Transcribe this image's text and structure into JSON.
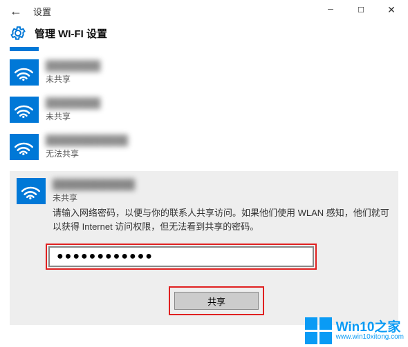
{
  "titlebar": {
    "title": "设置"
  },
  "header": {
    "title": "管理 WI-FI 设置"
  },
  "networks": [
    {
      "name": "████████",
      "status": "未共享"
    },
    {
      "name": "████████",
      "status": "未共享"
    },
    {
      "name": "████████████",
      "status": "无法共享"
    }
  ],
  "selected": {
    "name": "████████████",
    "status": "未共享",
    "description": "请输入网络密码，以便与你的联系人共享访问。如果他们使用 WLAN 感知，他们就可以获得 Internet 访问权限，但无法看到共享的密码。",
    "password_value": "●●●●●●●●●●●●",
    "share_label": "共享"
  },
  "watermark": {
    "line1": "Win10之家",
    "line2": "www.win10xitong.com"
  }
}
